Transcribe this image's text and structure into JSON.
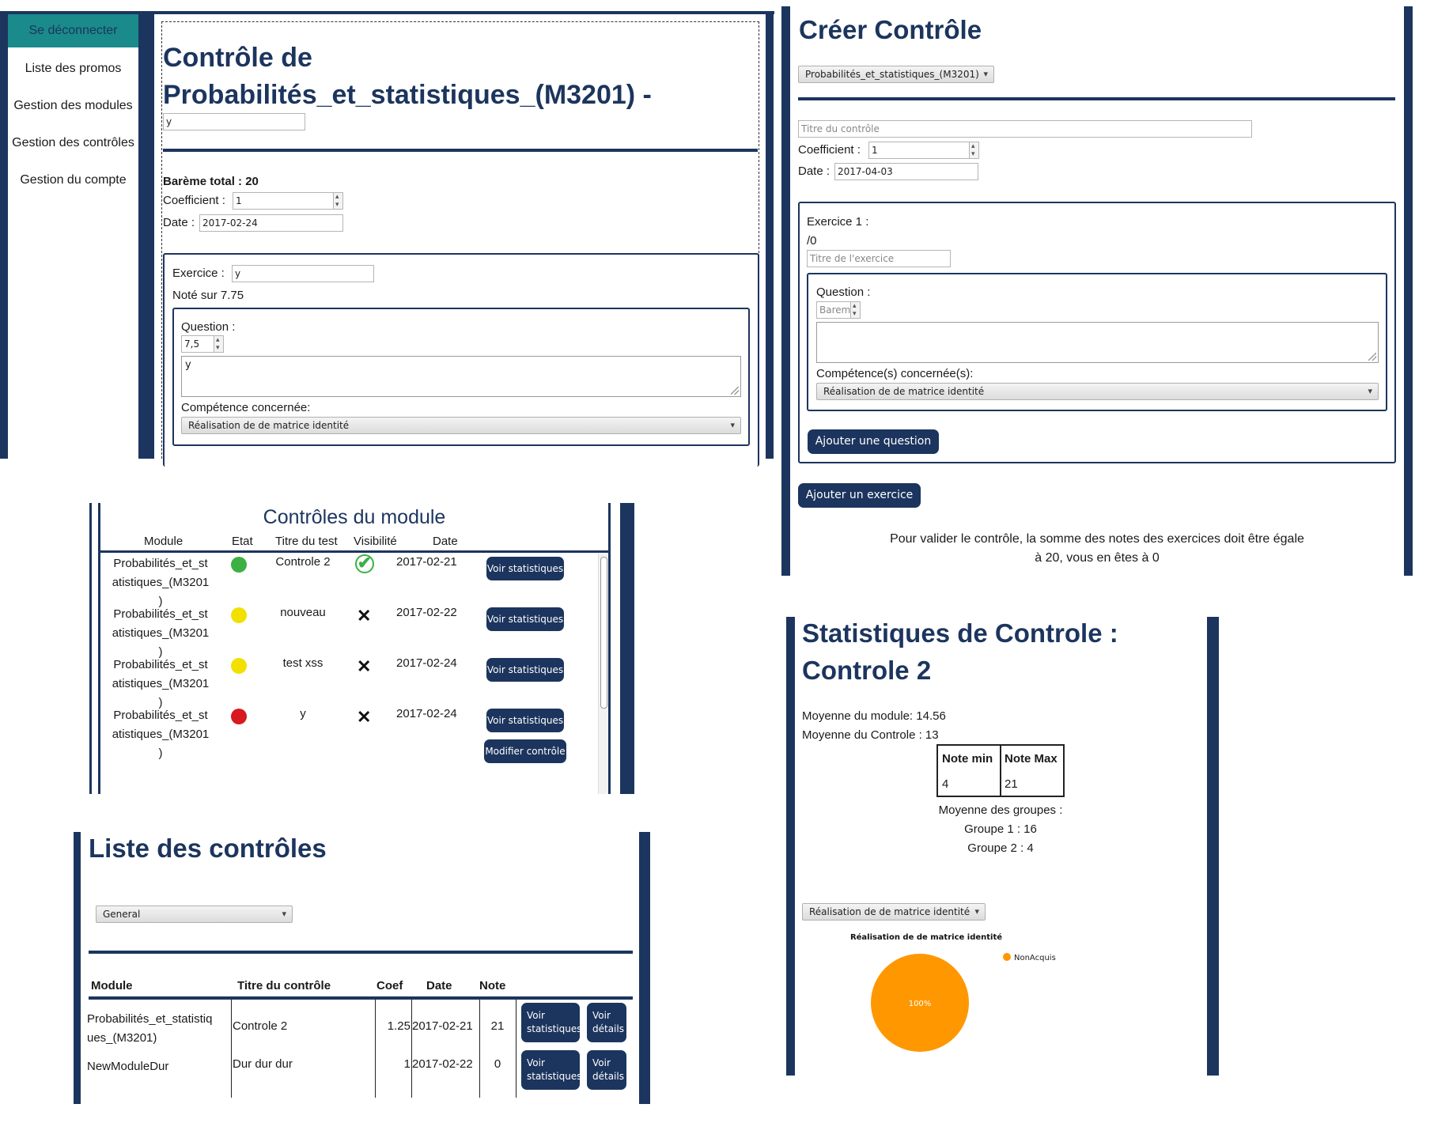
{
  "colors": {
    "navy": "#1c355e",
    "teal": "#1a8a8a",
    "green": "#3cb043",
    "yellow": "#f2e000",
    "red": "#d71920",
    "orange": "#ff9800"
  },
  "p1": {
    "logout": "Se déconnecter",
    "nav": [
      "Liste des promos",
      "Gestion des modules",
      "Gestion des contrôles",
      "Gestion du compte"
    ],
    "title_line1": "Contrôle de",
    "title_line2": "Probabilités_et_statistiques_(M3201) -",
    "title_value": "y",
    "bareme": "Barème total : 20",
    "coef_label": "Coefficient :",
    "coef_value": "1",
    "date_label": "Date :",
    "date_value": "2017-02-24",
    "exercise_label": "Exercice :",
    "exercise_value": "y",
    "note_sur": "Noté sur 7.75",
    "question_label": "Question :",
    "question_points": "7,5",
    "question_text": "y",
    "competence_label": "Compétence concernée:",
    "competence_value": "Réalisation de de matrice identité"
  },
  "p2": {
    "title": "Créer Contrôle",
    "module_select": "Probabilités_et_statistiques_(M3201)",
    "title_placeholder": "Titre du contrôle",
    "coef_label": "Coefficient :",
    "coef_value": "1",
    "date_label": "Date :",
    "date_value": "2017-04-03",
    "exercise_label": "Exercice 1 :",
    "exercise_score": "/0",
    "exercise_placeholder": "Titre de l'exercice",
    "question_label": "Question :",
    "bareme_placeholder": "Bareme",
    "competences_label": "Compétence(s) concernée(s):",
    "competence_value": "Réalisation de de matrice identité",
    "add_question": "Ajouter une question",
    "add_exercise": "Ajouter un exercice",
    "validation_line1": "Pour valider le contrôle, la somme des notes des exercices doit être égale",
    "validation_line2": "à 20, vous en êtes à 0"
  },
  "p3": {
    "title": "Contrôles du module",
    "headers": [
      "Module",
      "Etat",
      "Titre du test",
      "Visibilité",
      "Date"
    ],
    "rows": [
      {
        "module_l1": "Probabilités_et_st",
        "module_l2": "atistiques_(M3201",
        "module_l3": ")",
        "state": "green",
        "title": "Controle 2",
        "visible": true,
        "date": "2017-02-21",
        "btn": "Voir statistiques"
      },
      {
        "module_l1": "Probabilités_et_st",
        "module_l2": "atistiques_(M3201",
        "module_l3": ")",
        "state": "yellow",
        "title": "nouveau",
        "visible": false,
        "date": "2017-02-22",
        "btn": "Voir statistiques"
      },
      {
        "module_l1": "Probabilités_et_st",
        "module_l2": "atistiques_(M3201",
        "module_l3": ")",
        "state": "yellow",
        "title": "test xss",
        "visible": false,
        "date": "2017-02-24",
        "btn": "Voir statistiques"
      },
      {
        "module_l1": "Probabilités_et_st",
        "module_l2": "atistiques_(M3201",
        "module_l3": ")",
        "state": "red",
        "title": "y",
        "visible": false,
        "date": "2017-02-24",
        "btn": "Voir statistiques",
        "btn2": "Modifier contrôle"
      }
    ]
  },
  "p4": {
    "title": "Liste des contrôles",
    "select": "General",
    "headers": [
      "Module",
      "Titre du contrôle",
      "Coef",
      "Date",
      "Note"
    ],
    "rows": [
      {
        "module_l1": "Probabilités_et_statistiq",
        "module_l2": "ues_(M3201)",
        "title": "Controle 2",
        "coef": "1.25",
        "date": "2017-02-21",
        "note": "21",
        "btn1_l1": "Voir",
        "btn1_l2": "statistiques",
        "btn2_l1": "Voir",
        "btn2_l2": "détails"
      },
      {
        "module_l1": "NewModuleDur",
        "module_l2": "",
        "title": "Dur dur dur",
        "coef": "1",
        "date": "2017-02-22",
        "note": "0",
        "btn1_l1": "Voir",
        "btn1_l2": "statistiques",
        "btn2_l1": "Voir",
        "btn2_l2": "détails"
      }
    ]
  },
  "p5": {
    "title_line1": "Statistiques de Controle :",
    "title_line2": "Controle 2",
    "moyenne_module": "Moyenne du module: 14.56",
    "moyenne_controle": "Moyenne du Controle : 13",
    "table_headers": [
      "Note min",
      "Note Max"
    ],
    "table_values": [
      "4",
      "21"
    ],
    "groupes_label": "Moyenne des groupes :",
    "groupes": [
      "Groupe 1 : 16",
      "Groupe 2 : 4"
    ],
    "competence_select": "Réalisation de de matrice identité"
  },
  "chart_data": {
    "type": "pie",
    "title": "Réalisation de de matrice identité",
    "categories": [
      "NonAcquis"
    ],
    "values": [
      100
    ],
    "labels": [
      "100%"
    ],
    "colors": [
      "#ff9800"
    ],
    "legend": "top-right"
  }
}
